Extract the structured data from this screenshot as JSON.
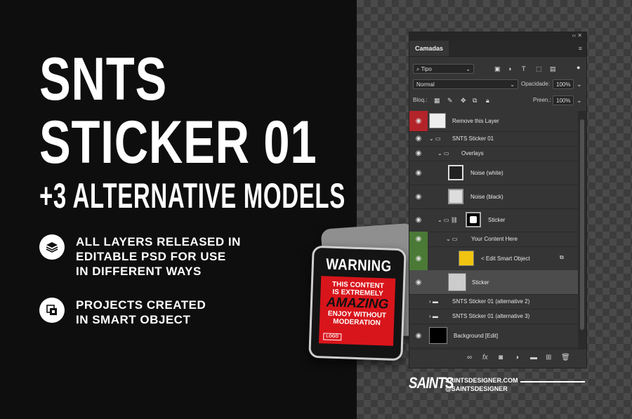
{
  "hero": {
    "title_line1": "SNTS",
    "title_line2": "STICKER 01",
    "subtitle": "+3 ALTERNATIVE MODELS"
  },
  "features": [
    {
      "icon": "layers-icon",
      "text": "ALL LAYERS RELEASED IN\nEDITABLE PSD FOR USE\nIN DIFFERENT WAYS"
    },
    {
      "icon": "smart-object-icon",
      "text": "PROJECTS CREATED\nIN SMART OBJECT"
    }
  ],
  "sticker": {
    "warning": "WARNING",
    "line1": "THIS CONTENT",
    "line2": "IS EXTREMELY",
    "line3": "AMAZING",
    "line4": "ENJOY WITHOUT",
    "line5": "MODERATION",
    "logo": "LOGO",
    "colors": {
      "red": "#d8151b",
      "dark": "#141414"
    }
  },
  "panel": {
    "collapse_glyph": "‹‹ ✕",
    "tab": "Camadas",
    "menu_glyph": "≡",
    "filter_value": "Tipo",
    "blend_mode": "Normal",
    "opacity_label": "Opacidade:",
    "opacity_value": "100%",
    "lock_label": "Bloq.:",
    "fill_label": "Preen.:",
    "fill_value": "100%",
    "layers": [
      {
        "name": "Remove this Layer",
        "indent": 0,
        "highlight": "red"
      },
      {
        "name": "SNTS Sticker 01",
        "indent": 0,
        "type": "group-open"
      },
      {
        "name": "Overlays",
        "indent": 1,
        "type": "group-open"
      },
      {
        "name": "Noise (white)",
        "indent": 2,
        "type": "layer"
      },
      {
        "name": "Noise (black)",
        "indent": 2,
        "type": "layer"
      },
      {
        "name": "Sticker",
        "indent": 1,
        "type": "group-mask"
      },
      {
        "name": "Your Content Here",
        "indent": 2,
        "type": "group-open",
        "highlight": "green"
      },
      {
        "name": "< Edit Smart Object",
        "indent": 3,
        "type": "smart",
        "highlight": "green"
      },
      {
        "name": "Sticker",
        "indent": 2,
        "type": "layer",
        "selected": true
      },
      {
        "name": "SNTS Sticker 01 (alternative 2)",
        "indent": 0,
        "type": "group-closed"
      },
      {
        "name": "SNTS Sticker 01 (alternative 3)",
        "indent": 0,
        "type": "group-closed"
      },
      {
        "name": "Background [Edit]",
        "indent": 0,
        "type": "layer"
      }
    ],
    "footer_icons": [
      "link-icon",
      "fx-icon",
      "mask-icon",
      "adjustment-icon",
      "folder-icon",
      "new-layer-icon",
      "trash-icon"
    ],
    "footer_link_glyph": "∞",
    "footer_fx_glyph": "fx",
    "footer_mask_glyph": "◙",
    "footer_adjust_glyph": "◑",
    "footer_folder_glyph": "▬",
    "footer_new_glyph": "⊞",
    "footer_trash_glyph": "🗑"
  },
  "brand": {
    "logo": "SAINTS",
    "site": "SAINTSDESIGNER.COM",
    "handle": "@SAINTSDESIGNER"
  }
}
